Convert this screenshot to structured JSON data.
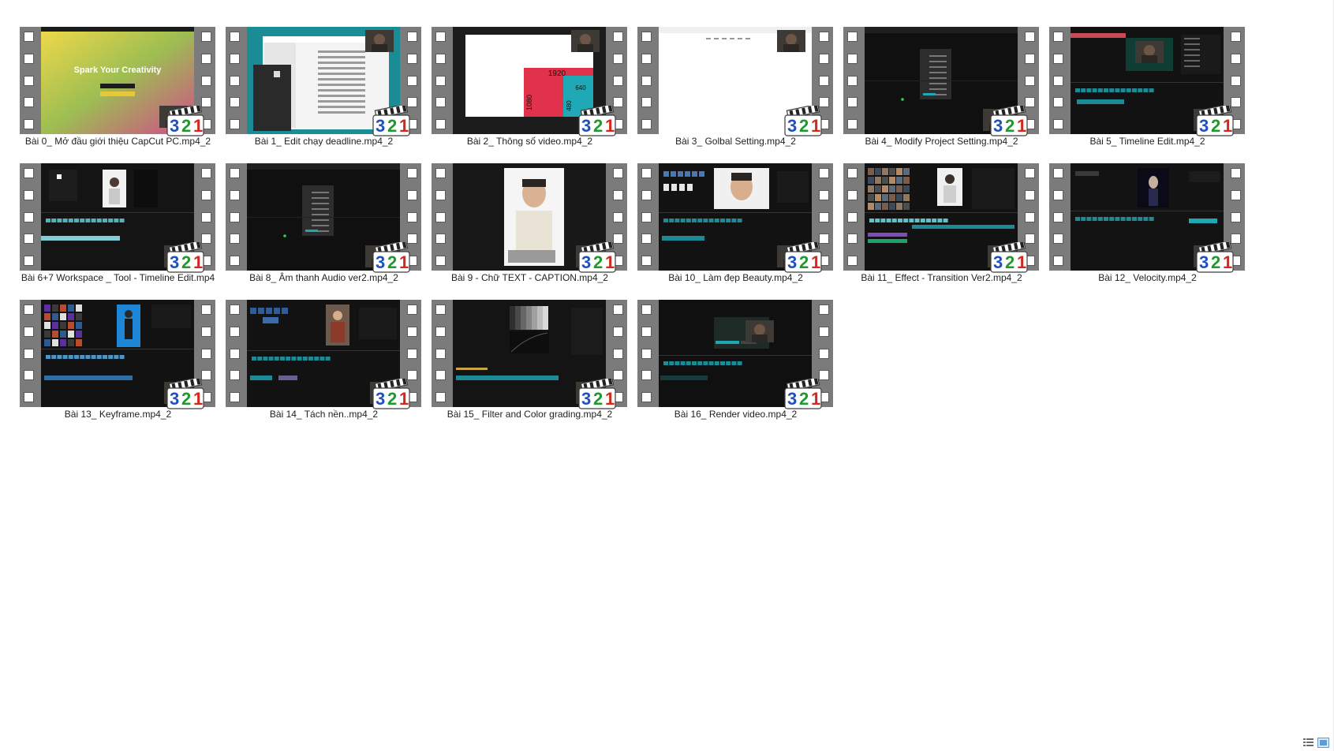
{
  "files": [
    {
      "name": "Bài 0_ Mở đầu giới thiệu CapCut PC.mp4_2",
      "preview": "gradient-title",
      "preview_text": "Spark Your Creativity"
    },
    {
      "name": "Bài 1_ Edit chạy deadline.mp4_2",
      "preview": "file-dialog"
    },
    {
      "name": "Bài 2_ Thông số video.mp4_2",
      "preview": "resolution-diagram",
      "preview_values": [
        "1920",
        "1080",
        "640",
        "480"
      ]
    },
    {
      "name": "Bài 3_ Golbal Setting.mp4_2",
      "preview": "white-page"
    },
    {
      "name": "Bài 4_ Modify Project Setting.mp4_2",
      "preview": "dark-dialog"
    },
    {
      "name": "Bài 5_ Timeline Edit.mp4_2",
      "preview": "editor-timeline"
    },
    {
      "name": "Bài 6+7 Workspace _ Tool - Timeline Edit.mp4",
      "preview": "editor-portrait"
    },
    {
      "name": "Bài 8_ Âm thanh Audio ver2.mp4_2",
      "preview": "dark-dialog"
    },
    {
      "name": "Bài 9 - Chữ TEXT - CAPTION.mp4_2",
      "preview": "person-closeup"
    },
    {
      "name": "Bài 10_ Làm đẹp Beauty.mp4_2",
      "preview": "editor-face"
    },
    {
      "name": "Bài 11_ Effect - Transition Ver2.mp4_2",
      "preview": "editor-effects"
    },
    {
      "name": "Bài 12_ Velocity.mp4_2",
      "preview": "editor-dark-figure"
    },
    {
      "name": "Bài 13_ Keyframe.mp4_2",
      "preview": "editor-blue"
    },
    {
      "name": "Bài 14_ Tách nền..mp4_2",
      "preview": "editor-person"
    },
    {
      "name": "Bài 15_ Filter and Color grading.mp4_2",
      "preview": "color-grading"
    },
    {
      "name": "Bài 16_ Render video.mp4_2",
      "preview": "render-dialog"
    }
  ],
  "badge": {
    "digits": [
      "3",
      "2",
      "1"
    ],
    "colors": [
      "#1f4fc1",
      "#1d9a2b",
      "#d2281e"
    ]
  },
  "icons": {
    "file_icon": "film-strip-icon",
    "badge_icon": "media-player-classic-321-icon",
    "details_view": "details-view-icon",
    "large_icons_view": "large-icons-view-icon"
  }
}
